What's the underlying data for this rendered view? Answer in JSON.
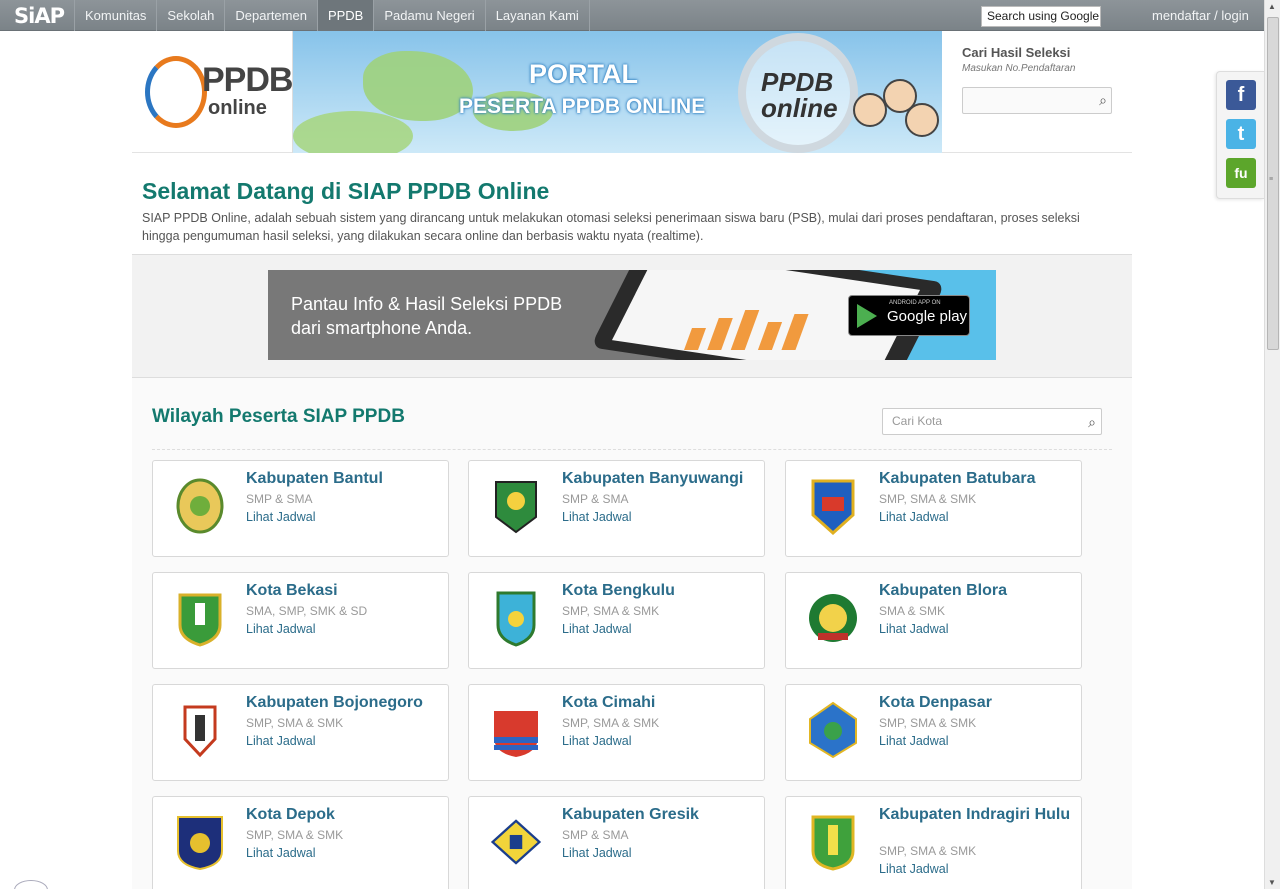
{
  "topnav": {
    "logo": "SiAP",
    "menu": [
      "Komunitas",
      "Sekolah",
      "Departemen",
      "PPDB",
      "Padamu Negeri",
      "Layanan Kami"
    ],
    "search_label": "Search using Google",
    "login_label": "mendaftar / login"
  },
  "header": {
    "logo_main": "PPDB",
    "logo_sub": "online",
    "banner_line1": "PORTAL",
    "banner_line2": "PESERTA PPDB ONLINE",
    "banner_badge": "PPDB online",
    "cari_title": "Cari Hasil Seleksi",
    "cari_hint": "Masukan No.Pendaftaran"
  },
  "welcome": {
    "title": "Selamat Datang di SIAP PPDB Online",
    "text": "SIAP PPDB Online, adalah sebuah sistem yang dirancang untuk melakukan otomasi seleksi penerimaan siswa baru (PSB), mulai dari proses pendaftaran, proses seleksi hingga pengumuman hasil seleksi, yang dilakukan secara online dan berbasis waktu nyata (realtime)."
  },
  "app_banner": {
    "line1": "Pantau Info & Hasil Seleksi PPDB",
    "line2": "dari smartphone Anda.",
    "store_small": "ANDROID APP ON",
    "store_name": "Google play"
  },
  "wilayah": {
    "title": "Wilayah Peserta SIAP PPDB",
    "search_placeholder": "Cari Kota",
    "cards": [
      {
        "name": "Kabupaten Bantul",
        "levels": "SMP & SMA",
        "link": "Lihat Jadwal"
      },
      {
        "name": "Kabupaten Banyuwangi",
        "levels": "SMP & SMA",
        "link": "Lihat Jadwal"
      },
      {
        "name": "Kabupaten Batubara",
        "levels": "SMP, SMA & SMK",
        "link": "Lihat Jadwal"
      },
      {
        "name": "Kota Bekasi",
        "levels": "SMA, SMP, SMK & SD",
        "link": "Lihat Jadwal"
      },
      {
        "name": "Kota Bengkulu",
        "levels": "SMP, SMA & SMK",
        "link": "Lihat Jadwal"
      },
      {
        "name": "Kabupaten Blora",
        "levels": "SMA & SMK",
        "link": "Lihat Jadwal"
      },
      {
        "name": "Kabupaten Bojonegoro",
        "levels": "SMP, SMA & SMK",
        "link": "Lihat Jadwal"
      },
      {
        "name": "Kota Cimahi",
        "levels": "SMP, SMA & SMK",
        "link": "Lihat Jadwal"
      },
      {
        "name": "Kota Denpasar",
        "levels": "SMP, SMA & SMK",
        "link": "Lihat Jadwal"
      },
      {
        "name": "Kota Depok",
        "levels": "SMP, SMA & SMK",
        "link": "Lihat Jadwal"
      },
      {
        "name": "Kabupaten Gresik",
        "levels": "SMP & SMA",
        "link": "Lihat Jadwal"
      },
      {
        "name": "Kabupaten Indragiri Hulu",
        "levels": "SMP, SMA & SMK",
        "link": "Lihat Jadwal"
      }
    ]
  },
  "colors": {
    "nav_bg": "#838a8f",
    "heading": "#13796e",
    "link": "#2b6c8a"
  },
  "icons": [
    "search-icon",
    "facebook-icon",
    "twitter-icon",
    "fu-share-icon"
  ]
}
